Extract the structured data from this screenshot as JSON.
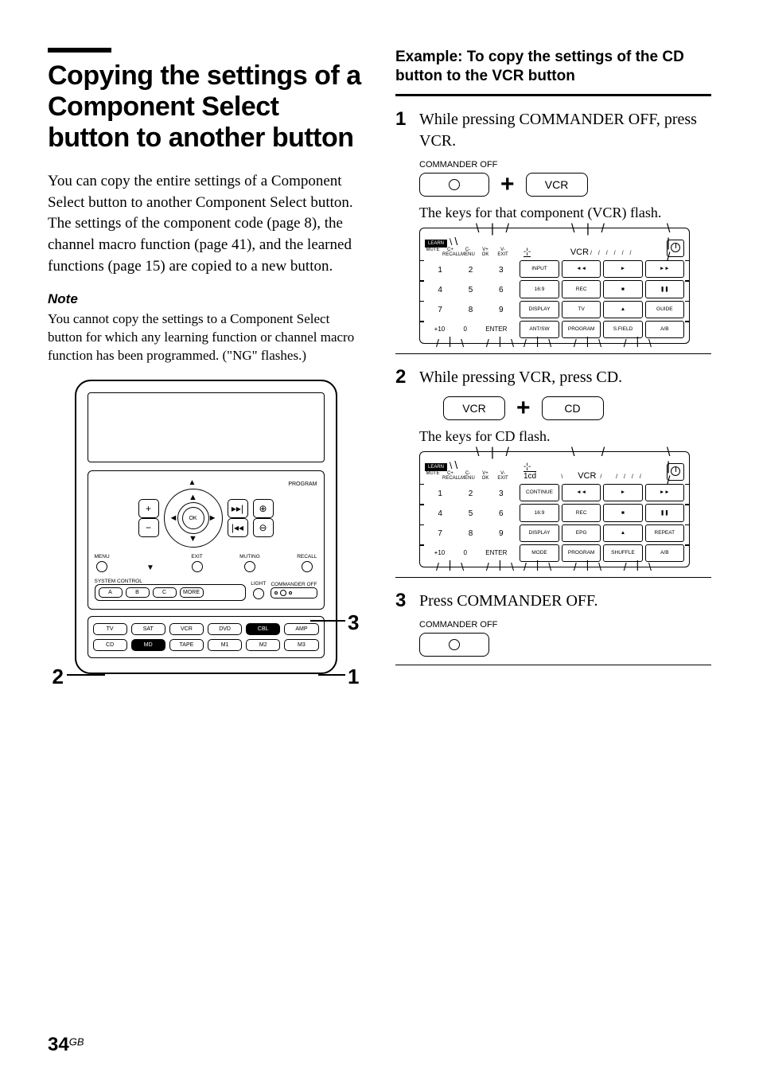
{
  "left": {
    "title": "Copying the settings of a Component Select button to another button",
    "intro": "You can copy the entire settings of a Component Select button to another Component Select button. The settings of the component code (page 8), the channel macro function (page 41), and the learned functions (page 15) are copied to a new button.",
    "note_head": "Note",
    "note_body": "You cannot copy the settings to a Component Select button for which any learning function or channel macro function has been programmed. (\"NG\" flashes.)"
  },
  "remote": {
    "ok": "OK",
    "program": "PROGRAM",
    "menu": "MENU",
    "exit": "EXIT",
    "muting": "MUTING",
    "recall": "RECALL",
    "system_control": "SYSTEM CONTROL",
    "a": "A",
    "b": "B",
    "c": "C",
    "more": "MORE",
    "light": "LIGHT",
    "commander_off": "COMMANDER OFF",
    "row1": [
      "TV",
      "SAT",
      "VCR",
      "DVD",
      "CBL",
      "AMP"
    ],
    "row2": [
      "CD",
      "MD",
      "TAPE",
      "M1",
      "M2",
      "M3"
    ],
    "callouts": {
      "c1": "1",
      "c2": "2",
      "c3": "3"
    }
  },
  "right": {
    "example_title": "Example: To copy the settings of the CD button to the VCR button",
    "step1_num": "1",
    "step1_text": "While pressing COMMANDER OFF, press VCR.",
    "cmd_off_label": "COMMANDER OFF",
    "btn_vcr": "VCR",
    "step1_after": "The keys for that component (VCR) flash.",
    "step2_num": "2",
    "step2_text": "While pressing VCR, press CD.",
    "btn_cd": "CD",
    "step2_after": "The keys for CD flash.",
    "step3_num": "3",
    "step3_text": "Press COMMANDER OFF."
  },
  "lcd_common": {
    "learn": "LEARN",
    "top_labels": [
      "MUTE",
      "RECALL",
      "MENU",
      "OK",
      "EXIT"
    ],
    "top_labels_sup": [
      "",
      "C+",
      "C-",
      "V+",
      "V-",
      ""
    ],
    "nums": [
      [
        "1",
        "2",
        "3"
      ],
      [
        "4",
        "5",
        "6"
      ],
      [
        "7",
        "8",
        "9"
      ],
      [
        "+10",
        "0",
        "ENTER"
      ]
    ]
  },
  "lcd1": {
    "mode": "VCR",
    "col0": [
      "INPUT",
      "16:9",
      "DISPLAY",
      "ANT/SW"
    ],
    "col1": [
      "◄◄",
      "REC",
      "TV",
      "PROGRAM"
    ],
    "col2": [
      "►",
      "■",
      "▲",
      "S.FIELD"
    ],
    "col3": [
      "►►",
      "❚❚",
      "GUIDE",
      "A/B"
    ]
  },
  "lcd2": {
    "mode": "VCR",
    "extra": "1cd",
    "col0": [
      "CONTINUE",
      "16:9",
      "DISPLAY",
      "MODE"
    ],
    "col1": [
      "◄◄",
      "REC",
      "EPG",
      "PROGRAM"
    ],
    "col2": [
      "►",
      "■",
      "▲",
      "SHUFFLE"
    ],
    "col3": [
      "►►",
      "❚❚",
      "REPEAT",
      "A/B"
    ]
  },
  "page": {
    "num": "34",
    "suffix": "GB"
  }
}
